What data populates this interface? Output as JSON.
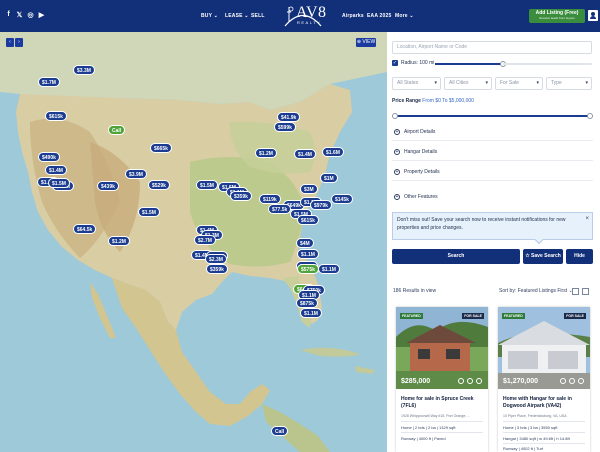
{
  "header": {
    "social": [
      "f",
      "𝕏",
      "◎",
      "▶"
    ],
    "nav": [
      {
        "label": "BUY ⌄",
        "key": "buy"
      },
      {
        "label": "LEASE ⌄",
        "key": "lease"
      },
      {
        "label": "SELL",
        "key": "sell"
      },
      {
        "label": "Airparks",
        "key": "airparks"
      },
      {
        "label": "EAA 2025",
        "key": "eaa"
      },
      {
        "label": "More ⌄",
        "key": "more"
      }
    ],
    "logo_text": "AV8",
    "logo_sub": "REALTY",
    "add_listing_label": "Add Listing (Free)",
    "add_listing_sub": "Receive leads from buyers",
    "colors": {
      "header_bg": "#12307a",
      "accent_green": "#3b8d3e",
      "marker_blue": "#1b3c8f",
      "marker_green": "#4fa33a"
    }
  },
  "map": {
    "collapse_label": "‹ ›",
    "view_label": "⊕ VIEW",
    "markers": [
      {
        "label": "$1.7M",
        "green": false
      },
      {
        "label": "$3.3M",
        "green": false
      },
      {
        "label": "$615k",
        "green": false
      },
      {
        "label": "Call",
        "green": true
      },
      {
        "label": "$665k",
        "green": false
      },
      {
        "label": "$41.9k",
        "green": false
      },
      {
        "label": "$599k",
        "green": false
      },
      {
        "label": "$490k",
        "green": false
      },
      {
        "label": "$1.4M",
        "green": false
      },
      {
        "label": "$1.2M",
        "green": false
      },
      {
        "label": "$1.4M",
        "green": false
      },
      {
        "label": "$1.6M",
        "green": false
      },
      {
        "label": "$4.5M",
        "green": false
      },
      {
        "label": "$1.1M",
        "green": false
      },
      {
        "label": "$1.5M",
        "green": false
      },
      {
        "label": "$3.9M",
        "green": false
      },
      {
        "label": "$529k",
        "green": false
      },
      {
        "label": "$1M",
        "green": false
      },
      {
        "label": "$3M",
        "green": false
      },
      {
        "label": "$1.5M",
        "green": false
      },
      {
        "label": "$439k",
        "green": false
      },
      {
        "label": "$1.5M",
        "green": false
      },
      {
        "label": "$1.1M",
        "green": false
      },
      {
        "label": "$359k",
        "green": false
      },
      {
        "label": "$119k",
        "green": false
      },
      {
        "label": "$649k",
        "green": false
      },
      {
        "label": "$1.1M",
        "green": false
      },
      {
        "label": "$979k",
        "green": false
      },
      {
        "label": "$145k",
        "green": false
      },
      {
        "label": "$77.5k",
        "green": false
      },
      {
        "label": "$1.5M",
        "green": false
      },
      {
        "label": "$615k",
        "green": false
      },
      {
        "label": "$1.5M",
        "green": false
      },
      {
        "label": "$1.2M",
        "green": false
      },
      {
        "label": "$64.5k",
        "green": false
      },
      {
        "label": "$1.4M",
        "green": false
      },
      {
        "label": "$1.3M",
        "green": false
      },
      {
        "label": "$2.7M",
        "green": false
      },
      {
        "label": "$1.4M",
        "green": false
      },
      {
        "label": "$1.6M",
        "green": false
      },
      {
        "label": "$2.3M",
        "green": false
      },
      {
        "label": "$359k",
        "green": false
      },
      {
        "label": "$4M",
        "green": false
      },
      {
        "label": "$1.1M",
        "green": false
      },
      {
        "label": "$725k",
        "green": false
      },
      {
        "label": "$575k",
        "green": true
      },
      {
        "label": "$1.1M",
        "green": false
      },
      {
        "label": "$649k",
        "green": true
      },
      {
        "label": "$750k",
        "green": false
      },
      {
        "label": "$1.1M",
        "green": false
      },
      {
        "label": "$875k",
        "green": false
      },
      {
        "label": "$1.1M",
        "green": false
      },
      {
        "label": "Call",
        "green": false
      }
    ]
  },
  "filters": {
    "location_placeholder": "Location, Airport Name or Code",
    "radius_label": "Radius: 100 mi",
    "state": "All States",
    "city": "All Cities",
    "type_for": "For Sale",
    "property_type": "Type",
    "price_range_label": "Price Range",
    "price_range_value": "From $0 To $5,000,000",
    "price_range_fraction": 1.0,
    "accordions": [
      "Airport Details",
      "Hangar Details",
      "Property Details",
      "Other Features"
    ],
    "notice": "Don't miss out! Save your search now to receive instant notifications for new properties and price changes.",
    "search_label": "Search",
    "save_search_label": "☆ Save Search",
    "hide_label": "Hide"
  },
  "results": {
    "count_text": "186 Results in view",
    "sort_label": "Sort by: Featured Listings First ⌄",
    "cards": [
      {
        "badge": "FEATURED",
        "status": "FOR SALE",
        "price": "$285,000",
        "title": "Home for sale in Spruce Creek (7FL6)",
        "address": "1928 Whippoorwill Way #15, Port Orange, ...",
        "line1": "Home | 2 bds | 2 ba | 1329 sqft",
        "line2": "Runway | 4000 ft | Paved"
      },
      {
        "badge": "FEATURED",
        "status": "FOR SALE",
        "price": "$1,270,000",
        "title": "Home with Hangar for sale in Dogwood Airpark (VA42)",
        "address": "10 Piper Place, Fredericksburg, VA, USA",
        "line1": "Home | 3 bds | 3 ba | 3550 sqft",
        "line2": "Hangar | 3480 sqft | w 49.6ft | h 14.8ft",
        "line3": "Runway | 4002 ft | Turf"
      }
    ]
  }
}
